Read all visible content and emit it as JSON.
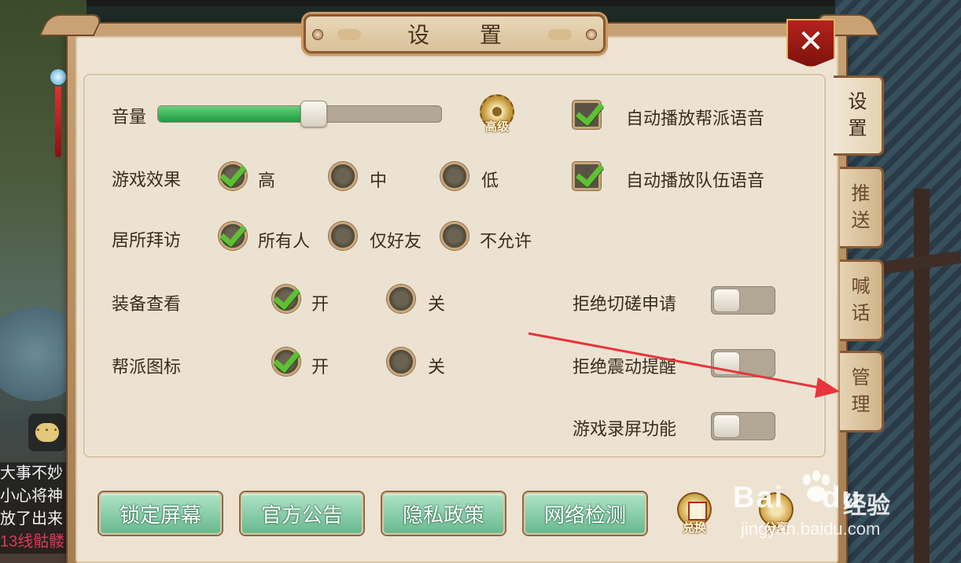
{
  "title": "设 置",
  "close_label": "✕",
  "side_tabs": [
    {
      "label": "设置",
      "chars": [
        "设",
        "置"
      ]
    },
    {
      "label": "推送",
      "chars": [
        "推",
        "送"
      ]
    },
    {
      "label": "喊话",
      "chars": [
        "喊",
        "话"
      ]
    },
    {
      "label": "管理",
      "chars": [
        "管",
        "理"
      ]
    }
  ],
  "volume": {
    "label": "音量",
    "value_fraction": 0.55,
    "advanced_label": "高级"
  },
  "game_effect": {
    "label": "游戏效果",
    "options": [
      "高",
      "中",
      "低"
    ],
    "selected": "高"
  },
  "residence_visit": {
    "label": "居所拜访",
    "options": [
      "所有人",
      "仅好友",
      "不允许"
    ],
    "selected": "所有人"
  },
  "equipment_view": {
    "label": "装备查看",
    "options": [
      "开",
      "关"
    ],
    "selected": "开"
  },
  "guild_icon": {
    "label": "帮派图标",
    "options": [
      "开",
      "关"
    ],
    "selected": "开"
  },
  "auto_play": [
    {
      "label": "自动播放帮派语音",
      "checked": true
    },
    {
      "label": "自动播放队伍语音",
      "checked": true
    }
  ],
  "toggles": [
    {
      "label": "拒绝切磋申请",
      "on": false
    },
    {
      "label": "拒绝震动提醒",
      "on": false
    },
    {
      "label": "游戏录屏功能",
      "on": false
    }
  ],
  "bottom_buttons": [
    "锁定屏幕",
    "官方公告",
    "隐私政策",
    "网络检测"
  ],
  "round_buttons": [
    "兑换",
    "分享"
  ],
  "chat_log": {
    "lines": [
      "大事不妙",
      "小心将神",
      "放了出来",
      "13线骷髅"
    ]
  },
  "watermark": {
    "brand": "Bai",
    "brand_suffix": "du",
    "brand_cn": "经验",
    "url": "jingyan.baidu.com"
  },
  "colors": {
    "accent_green": "#1f9a3f",
    "check_green": "#5fbf35",
    "frame_brown": "#8a5a34",
    "panel_bg": "#ece2d2",
    "close_red": "#b5231c",
    "annotation_red": "#e8343a"
  },
  "icons": {
    "advanced": "gear-icon",
    "exchange": "gift-icon",
    "share": "share-icon",
    "chat": "chat-bubble-icon"
  }
}
